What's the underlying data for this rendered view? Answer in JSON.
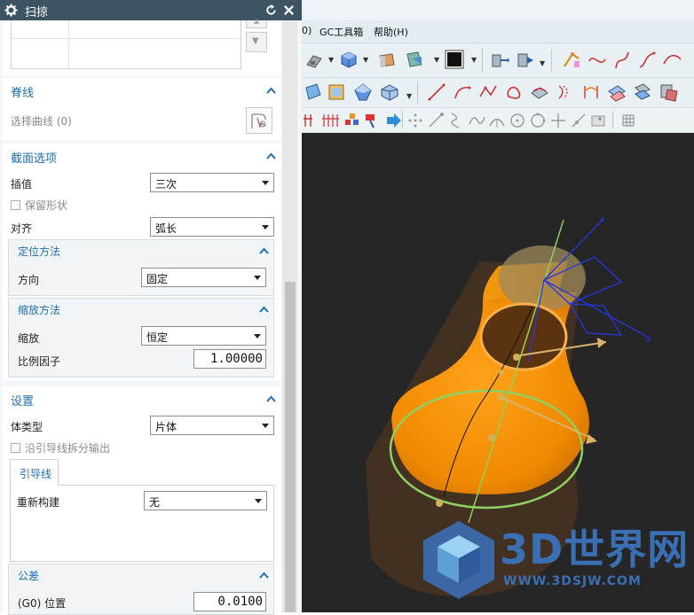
{
  "dialog": {
    "title": "扫掠",
    "spine": {
      "title": "脊线",
      "select_label": "选择曲线 (0)"
    },
    "section_options": {
      "title": "截面选项",
      "interpolation": {
        "label": "插值",
        "value": "三次"
      },
      "preserve_shape": {
        "label": "保留形状",
        "checked": false
      },
      "alignment": {
        "label": "对齐",
        "value": "弧长"
      },
      "orientation": {
        "title": "定位方法",
        "direction": {
          "label": "方向",
          "value": "固定"
        }
      },
      "scaling": {
        "title": "缩放方法",
        "scale": {
          "label": "缩放",
          "value": "恒定"
        },
        "factor": {
          "label": "比例因子",
          "value": "1.00000"
        }
      }
    },
    "settings": {
      "title": "设置",
      "body_type": {
        "label": "体类型",
        "value": "片体"
      },
      "split_output": {
        "label": "沿引导线拆分输出",
        "checked": false
      },
      "guide_tab": "引导线",
      "rebuild": {
        "label": "重新构建",
        "value": "无"
      }
    },
    "tolerance": {
      "title": "公差",
      "g0": {
        "label": "(G0) 位置",
        "value": "0.0100"
      }
    }
  },
  "menubar": {
    "items": [
      "0)",
      "GC工具箱",
      "帮助(H)"
    ]
  },
  "watermark": {
    "text": "3D世界网",
    "url": "WWW.3DSJW.COM"
  },
  "colors": {
    "title_bar": "#3d5562",
    "accent": "#1f6fb0",
    "viewport_bg": "#262626",
    "model_orange": "#f08a00",
    "watermark_blue": "#3b6fb4"
  }
}
